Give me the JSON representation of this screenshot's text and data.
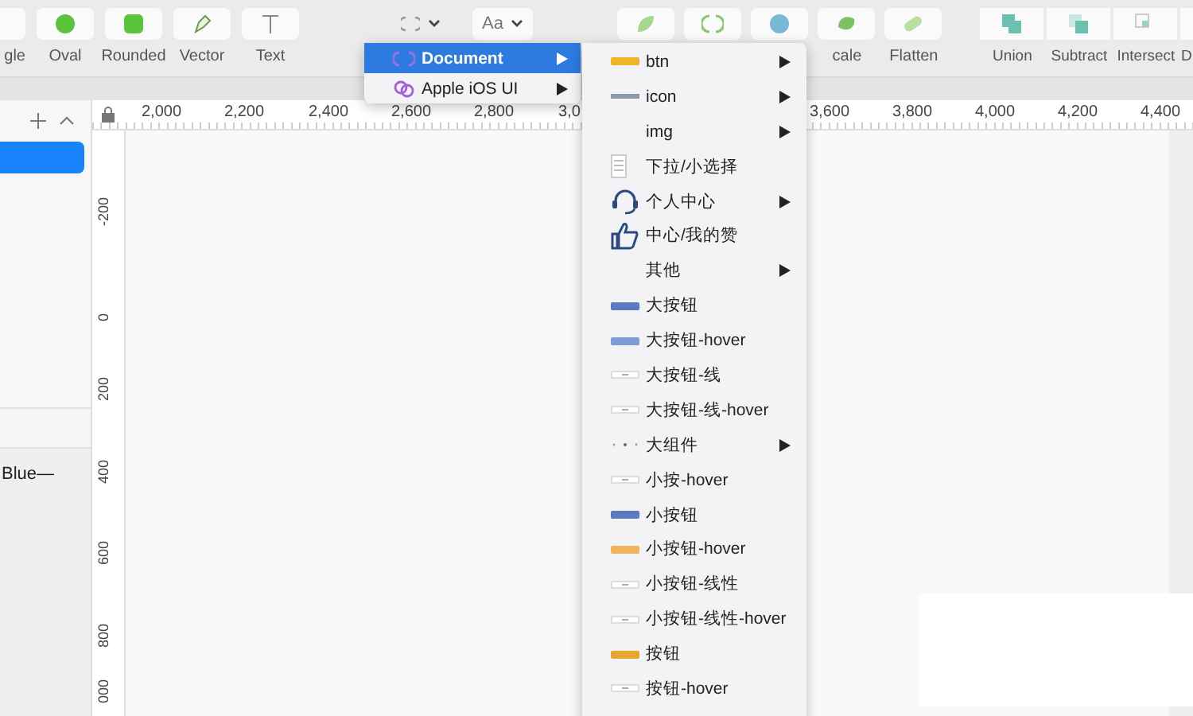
{
  "toolbar": {
    "tools": [
      {
        "kind": "partial",
        "label": "gle"
      },
      {
        "kind": "oval",
        "label": "Oval"
      },
      {
        "kind": "rounded",
        "label": "Rounded"
      },
      {
        "kind": "vector",
        "label": "Vector"
      },
      {
        "kind": "text",
        "label": "Text"
      }
    ],
    "text_style_dropdown": {
      "value": "Aa"
    },
    "edit_tools": [
      {
        "kind": "leaf"
      },
      {
        "kind": "rotate"
      },
      {
        "kind": "globe"
      },
      {
        "kind": "blob",
        "label": "cale"
      },
      {
        "kind": "pill",
        "label": "Flatten"
      }
    ],
    "boolean_tools": [
      {
        "kind": "union",
        "label": "Union"
      },
      {
        "kind": "subtract",
        "label": "Subtract"
      },
      {
        "kind": "intersect",
        "label": "Intersect"
      },
      {
        "kind": "difference",
        "label": "D"
      }
    ]
  },
  "layers_panel": {
    "selected_row": true,
    "label": "Blue—"
  },
  "ruler": {
    "x_labels": [
      "2,000",
      "2,200",
      "2,400",
      "2,600",
      "2,800",
      "3,0",
      "3,600",
      "3,800",
      "4,000",
      "4,200",
      "4,400"
    ],
    "y_labels": [
      "-200",
      "0",
      "200",
      "400",
      "600",
      "800",
      "000"
    ]
  },
  "symbols_menu": [
    {
      "label": "Document",
      "kind": "symbol",
      "selected": true,
      "submenu": true
    },
    {
      "label": "Apple iOS UI",
      "kind": "link",
      "selected": false,
      "submenu": true
    }
  ],
  "document_submenu": [
    {
      "label": "btn",
      "kind": "swatch",
      "color": "#f0b429",
      "submenu": true
    },
    {
      "label": "icon",
      "kind": "line",
      "submenu": true
    },
    {
      "label": "img",
      "kind": "blank",
      "submenu": true
    },
    {
      "label": "下拉/小选择",
      "kind": "doc",
      "submenu": false
    },
    {
      "label": "个人中心",
      "kind": "headset",
      "submenu": true
    },
    {
      "label": "中心/我的赞",
      "kind": "thumb",
      "submenu": false
    },
    {
      "label": "其他",
      "kind": "blank",
      "submenu": true
    },
    {
      "label": "大按钮",
      "kind": "swatch",
      "color": "#5b7bc0",
      "submenu": false
    },
    {
      "label": "大按钮-hover",
      "kind": "swatch",
      "color": "#7f9bd6",
      "submenu": false
    },
    {
      "label": "大按钮-线",
      "kind": "outline",
      "submenu": false
    },
    {
      "label": "大按钮-线-hover",
      "kind": "outline",
      "submenu": false
    },
    {
      "label": "大组件",
      "kind": "dots",
      "submenu": true
    },
    {
      "label": "小按-hover",
      "kind": "outline",
      "submenu": false
    },
    {
      "label": "小按钮",
      "kind": "swatch",
      "color": "#5b7bc0",
      "submenu": false
    },
    {
      "label": "小按钮-hover",
      "kind": "swatch",
      "color": "#f0b45a",
      "submenu": false
    },
    {
      "label": "小按钮-线性",
      "kind": "outline",
      "submenu": false
    },
    {
      "label": "小按钮-线性-hover",
      "kind": "outline",
      "submenu": false
    },
    {
      "label": "按钮",
      "kind": "swatch",
      "color": "#e8a530",
      "submenu": false
    },
    {
      "label": "按钮-hover",
      "kind": "outline",
      "submenu": false
    }
  ]
}
